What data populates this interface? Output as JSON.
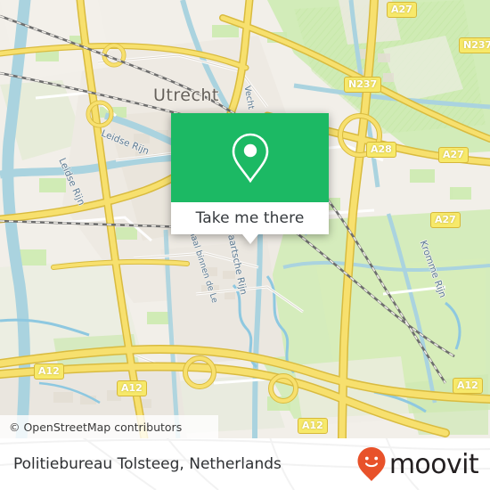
{
  "map": {
    "city_label": "Utrecht",
    "attribution": "© OpenStreetMap contributors",
    "water_labels": [
      {
        "name": "Leidse Rijn"
      },
      {
        "name": "Leidse Rijn"
      },
      {
        "name": "Vaartsche Rijn"
      },
      {
        "name": "Merwedekanaal binnen de Le"
      },
      {
        "name": "Kromme Rijn"
      },
      {
        "name": "Vecht"
      }
    ],
    "shields": [
      {
        "label": "A27"
      },
      {
        "label": "N237"
      },
      {
        "label": "N237"
      },
      {
        "label": "A28"
      },
      {
        "label": "A27"
      },
      {
        "label": "A27"
      },
      {
        "label": "A12"
      },
      {
        "label": "A12"
      },
      {
        "label": "A12"
      },
      {
        "label": "A12"
      }
    ],
    "colors": {
      "land": "#f2efe9",
      "water": "#aad3df",
      "park": "#cdebb0",
      "motorway": "#f7e06e",
      "rail": "#707070",
      "residential": "#ffffff"
    }
  },
  "popup": {
    "button_label": "Take me there",
    "pin_icon": "map-pin-icon",
    "accent_color": "#1cb964"
  },
  "footer": {
    "title": "Politiebureau Tolsteeg, Netherlands",
    "brand_name": "moovit",
    "brand_icon": "moovit-smiley-pin-icon",
    "brand_color": "#e8522a"
  }
}
